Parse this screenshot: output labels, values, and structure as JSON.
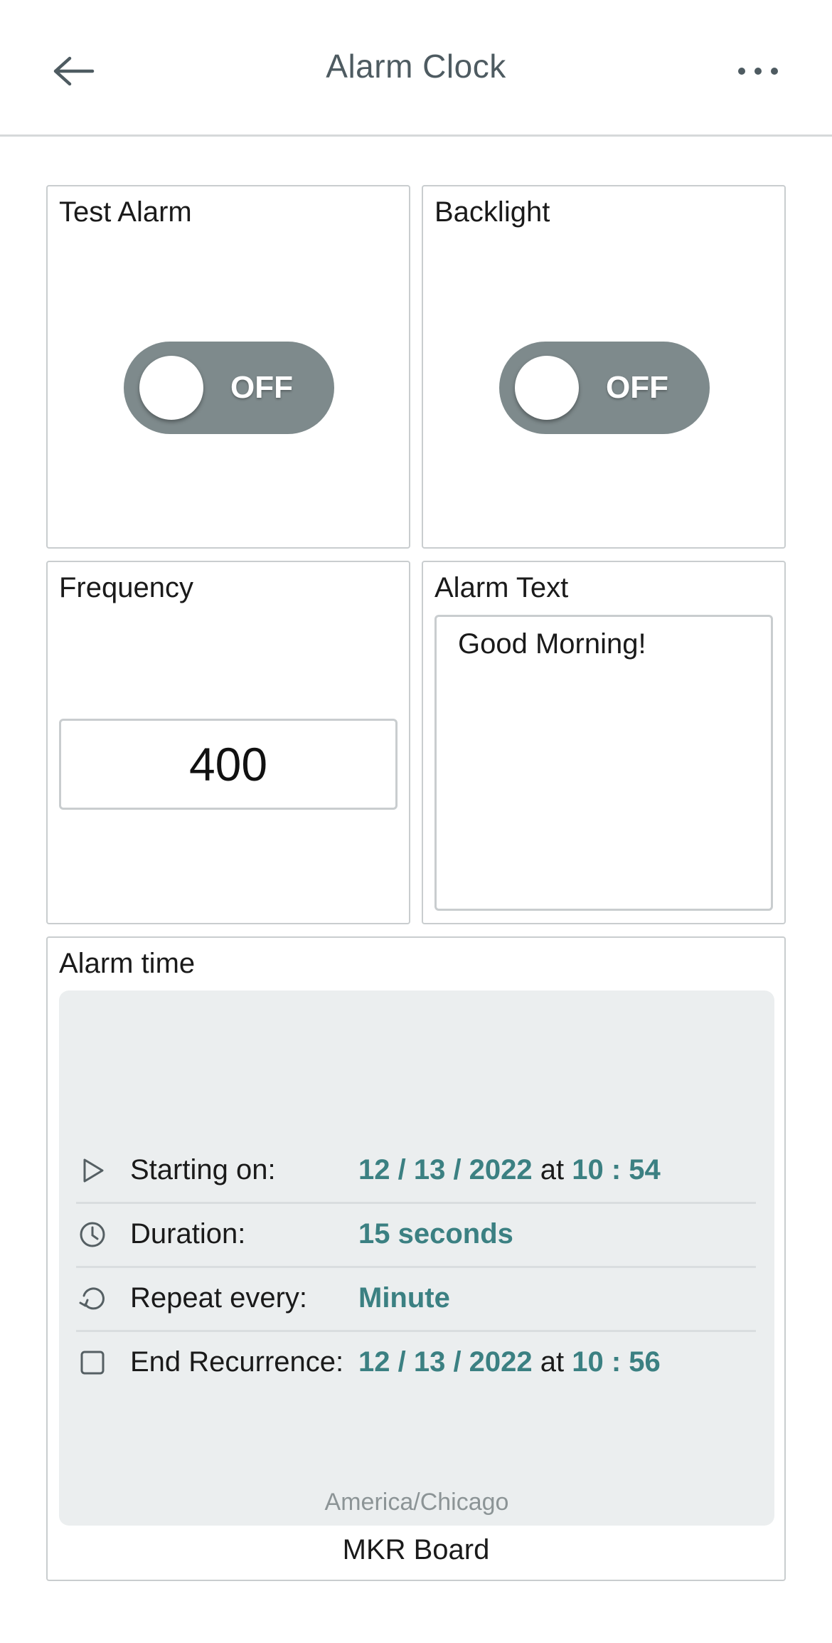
{
  "header": {
    "title": "Alarm Clock",
    "back_icon": "arrow-left-icon",
    "more_icon": "more-horizontal-icon"
  },
  "cards": {
    "test_alarm": {
      "title": "Test Alarm",
      "toggle_state": "OFF"
    },
    "backlight": {
      "title": "Backlight",
      "toggle_state": "OFF"
    },
    "frequency": {
      "title": "Frequency",
      "value": "400"
    },
    "alarm_text": {
      "title": "Alarm Text",
      "value": "Good Morning!"
    },
    "alarm_time": {
      "title": "Alarm time",
      "starting_on": {
        "label": "Starting on:",
        "date": "12 / 13 / 2022",
        "at": "at",
        "time": "10 : 54"
      },
      "duration": {
        "label": "Duration:",
        "value": "15 seconds"
      },
      "repeat": {
        "label": "Repeat every:",
        "value": "Minute"
      },
      "end_recurrence": {
        "label": "End Recurrence:",
        "date": "12 / 13 / 2022",
        "at": "at",
        "time": "10 : 56",
        "checked": false
      },
      "timezone": "America/Chicago",
      "device": "MKR Board"
    }
  },
  "colors": {
    "accent": "#3b8082",
    "toggle_off": "#7e8a8c",
    "panel_bg": "#ebeeef",
    "border": "#c9cdcf"
  }
}
